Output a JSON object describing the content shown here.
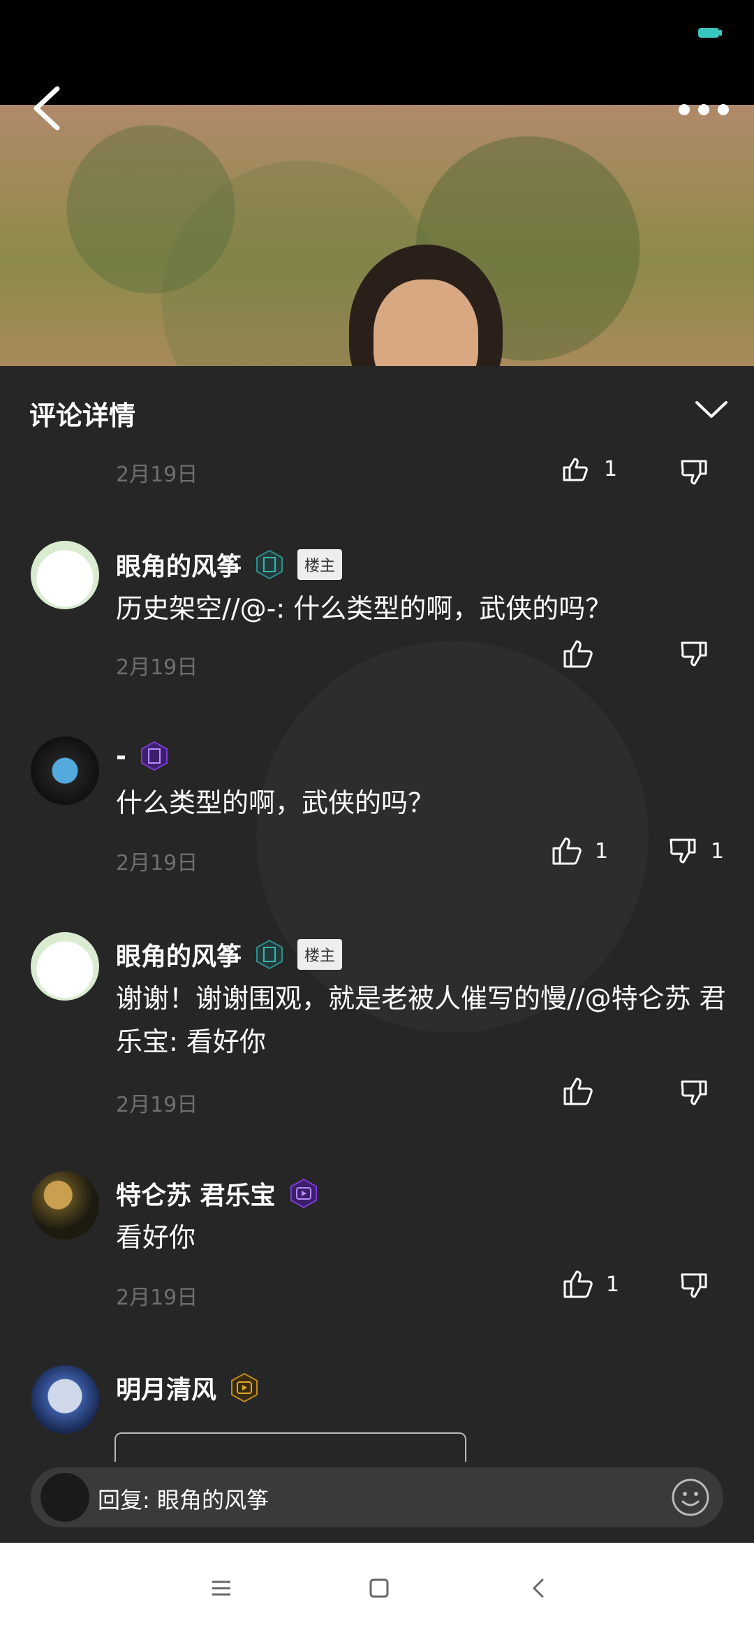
{
  "status_bar": {
    "battery_level": "4"
  },
  "panel": {
    "title": "评论详情"
  },
  "top_item": {
    "date": "2月19日",
    "like_count": "1"
  },
  "comments": [
    {
      "name": "眼角的风筝",
      "owner_tag": "楼主",
      "text": "历史架空//@-: 什么类型的啊，武侠的吗？",
      "date": "2月19日",
      "like_count": "",
      "dislike_count": ""
    },
    {
      "name": "-",
      "owner_tag": "",
      "text": "什么类型的啊，武侠的吗？",
      "date": "2月19日",
      "like_count": "1",
      "dislike_count": "1"
    },
    {
      "name": "眼角的风筝",
      "owner_tag": "楼主",
      "text": "谢谢！谢谢围观，就是老被人催写的慢//@特仑苏 君乐宝: 看好你",
      "date": "2月19日",
      "like_count": "",
      "dislike_count": ""
    },
    {
      "name": "特仑苏 君乐宝",
      "owner_tag": "",
      "text": "看好你",
      "date": "2月19日",
      "like_count": "1",
      "dislike_count": ""
    },
    {
      "name": "明月清风",
      "owner_tag": "",
      "text": "",
      "date": "",
      "like_count": "",
      "dislike_count": ""
    }
  ],
  "reply": {
    "placeholder": "回复: 眼角的风筝"
  },
  "colors": {
    "panel_bg": "#262626",
    "date_gray": "#6f6f6f",
    "purple_badge": "#7b3bd6",
    "teal_badge": "#2f8c8a"
  }
}
